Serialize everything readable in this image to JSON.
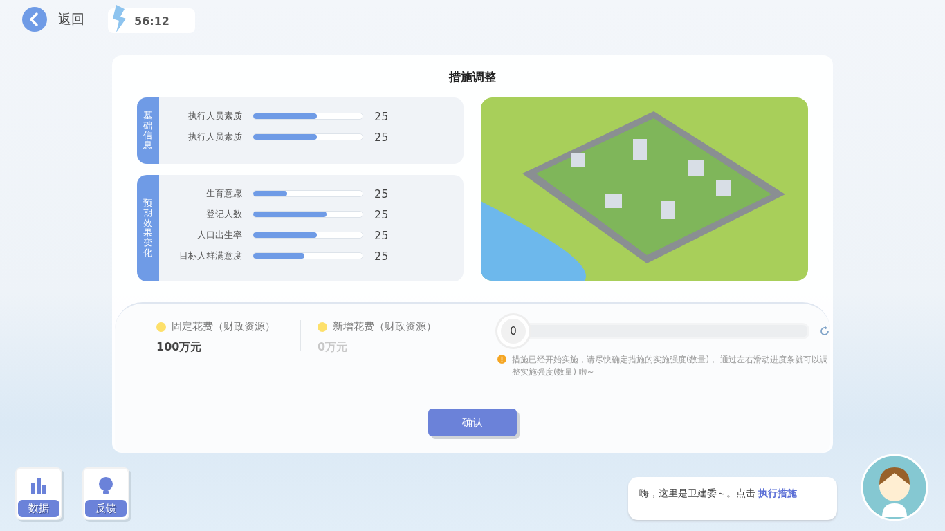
{
  "back_button": {
    "label": "返回"
  },
  "timer": {
    "value": "56:12"
  },
  "dialog": {
    "title": "措施调整",
    "sections": [
      {
        "label": "基础信息",
        "metrics": [
          {
            "name": "执行人员素质",
            "level": 0.58,
            "value": "25"
          },
          {
            "name": "执行人员素质",
            "level": 0.58,
            "value": "25"
          }
        ]
      },
      {
        "label": "预期效果变化",
        "metrics": [
          {
            "name": "生育意愿",
            "level": 0.31,
            "value": "25"
          },
          {
            "name": "登记人数",
            "level": 0.67,
            "value": "25"
          },
          {
            "name": "人口出生率",
            "level": 0.58,
            "value": "25"
          },
          {
            "name": "目标人群满意度",
            "level": 0.47,
            "value": "25"
          }
        ]
      }
    ],
    "costs": [
      {
        "label": "固定花费（财政资源）",
        "value": "100万元",
        "disabled": false
      },
      {
        "label": "新增花费（财政资源）",
        "value": "0万元",
        "disabled": true
      }
    ],
    "slider": {
      "value": "0",
      "level": 0
    },
    "hint": "措施已经开始实施，请尽快确定措施的实施强度(数量)， 通过左右滑动进度条就可以调整实施强度(数量) 啦~",
    "confirm_button": "确认"
  },
  "dock": [
    {
      "kind": "chart",
      "label": "数据"
    },
    {
      "kind": "bulb",
      "label": "反馈"
    }
  ],
  "assistant": {
    "message": "嗨，这里是卫建委～。点击 ",
    "link": "执行措施"
  }
}
